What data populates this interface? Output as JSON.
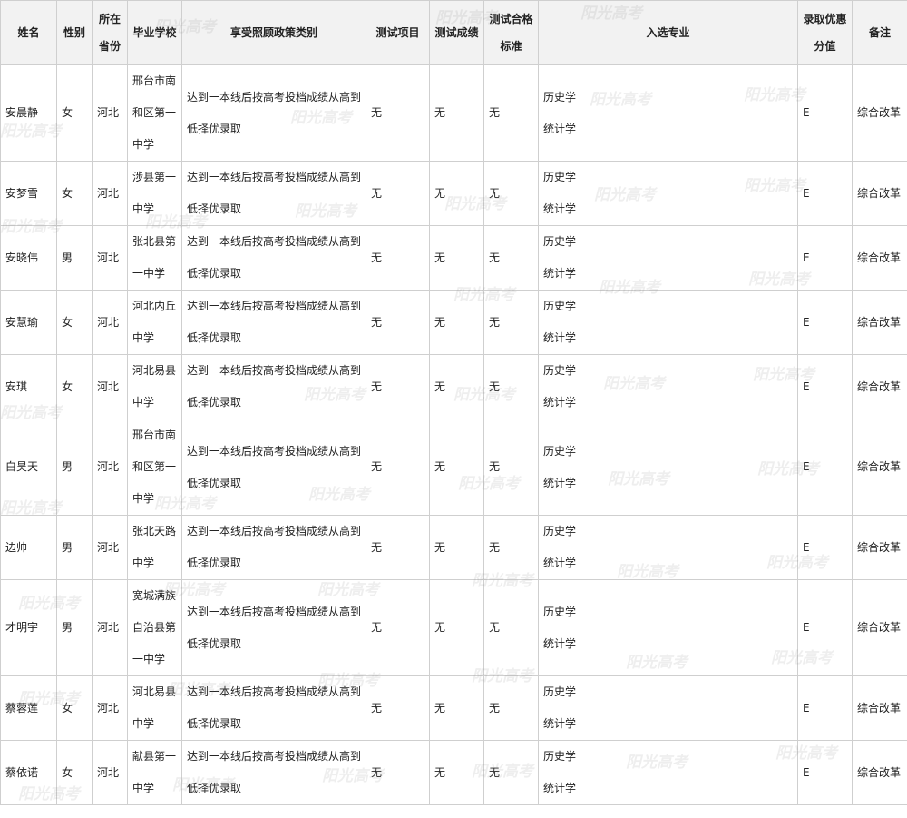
{
  "headers": {
    "name": "姓名",
    "gender": "性别",
    "province": "所在省份",
    "school": "毕业学校",
    "policy": "享受照顾政策类别",
    "test_item": "测试项目",
    "test_score": "测试成绩",
    "test_standard": "测试合格标准",
    "major": "入选专业",
    "bonus": "录取优惠分值",
    "remark": "备注"
  },
  "rows": [
    {
      "name": "安晨静",
      "gender": "女",
      "province": "河北",
      "school": "邢台市南和区第一中学",
      "policy": "达到一本线后按高考投档成绩从高到低择优录取",
      "test_item": "无",
      "test_score": "无",
      "test_standard": "无",
      "major": [
        "历史学",
        "统计学"
      ],
      "bonus": "E",
      "remark": "综合改革"
    },
    {
      "name": "安梦雪",
      "gender": "女",
      "province": "河北",
      "school": "涉县第一中学",
      "policy": "达到一本线后按高考投档成绩从高到低择优录取",
      "test_item": "无",
      "test_score": "无",
      "test_standard": "无",
      "major": [
        "历史学",
        "统计学"
      ],
      "bonus": "E",
      "remark": "综合改革"
    },
    {
      "name": "安晓伟",
      "gender": "男",
      "province": "河北",
      "school": "张北县第一中学",
      "policy": "达到一本线后按高考投档成绩从高到低择优录取",
      "test_item": "无",
      "test_score": "无",
      "test_standard": "无",
      "major": [
        "历史学",
        "统计学"
      ],
      "bonus": "E",
      "remark": "综合改革"
    },
    {
      "name": "安慧瑜",
      "gender": "女",
      "province": "河北",
      "school": "河北内丘中学",
      "policy": "达到一本线后按高考投档成绩从高到低择优录取",
      "test_item": "无",
      "test_score": "无",
      "test_standard": "无",
      "major": [
        "历史学",
        "统计学"
      ],
      "bonus": "E",
      "remark": "综合改革"
    },
    {
      "name": "安琪",
      "gender": "女",
      "province": "河北",
      "school": "河北易县中学",
      "policy": "达到一本线后按高考投档成绩从高到低择优录取",
      "test_item": "无",
      "test_score": "无",
      "test_standard": "无",
      "major": [
        "历史学",
        "统计学"
      ],
      "bonus": "E",
      "remark": "综合改革"
    },
    {
      "name": "白昊天",
      "gender": "男",
      "province": "河北",
      "school": "邢台市南和区第一中学",
      "policy": "达到一本线后按高考投档成绩从高到低择优录取",
      "test_item": "无",
      "test_score": "无",
      "test_standard": "无",
      "major": [
        "历史学",
        "统计学"
      ],
      "bonus": "E",
      "remark": "综合改革"
    },
    {
      "name": "边帅",
      "gender": "男",
      "province": "河北",
      "school": "张北天路中学",
      "policy": "达到一本线后按高考投档成绩从高到低择优录取",
      "test_item": "无",
      "test_score": "无",
      "test_standard": "无",
      "major": [
        "历史学",
        "统计学"
      ],
      "bonus": "E",
      "remark": "综合改革"
    },
    {
      "name": "才明宇",
      "gender": "男",
      "province": "河北",
      "school": "宽城满族自治县第一中学",
      "policy": "达到一本线后按高考投档成绩从高到低择优录取",
      "test_item": "无",
      "test_score": "无",
      "test_standard": "无",
      "major": [
        "历史学",
        "统计学"
      ],
      "bonus": "E",
      "remark": "综合改革"
    },
    {
      "name": "蔡蓉莲",
      "gender": "女",
      "province": "河北",
      "school": "河北易县中学",
      "policy": "达到一本线后按高考投档成绩从高到低择优录取",
      "test_item": "无",
      "test_score": "无",
      "test_standard": "无",
      "major": [
        "历史学",
        "统计学"
      ],
      "bonus": "E",
      "remark": "综合改革"
    },
    {
      "name": "蔡依诺",
      "gender": "女",
      "province": "河北",
      "school": "献县第一中学",
      "policy": "达到一本线后按高考投档成绩从高到低择优录取",
      "test_item": "无",
      "test_score": "无",
      "test_standard": "无",
      "major": [
        "历史学",
        "统计学"
      ],
      "bonus": "E",
      "remark": "综合改革"
    }
  ],
  "watermark": "阳光高考"
}
